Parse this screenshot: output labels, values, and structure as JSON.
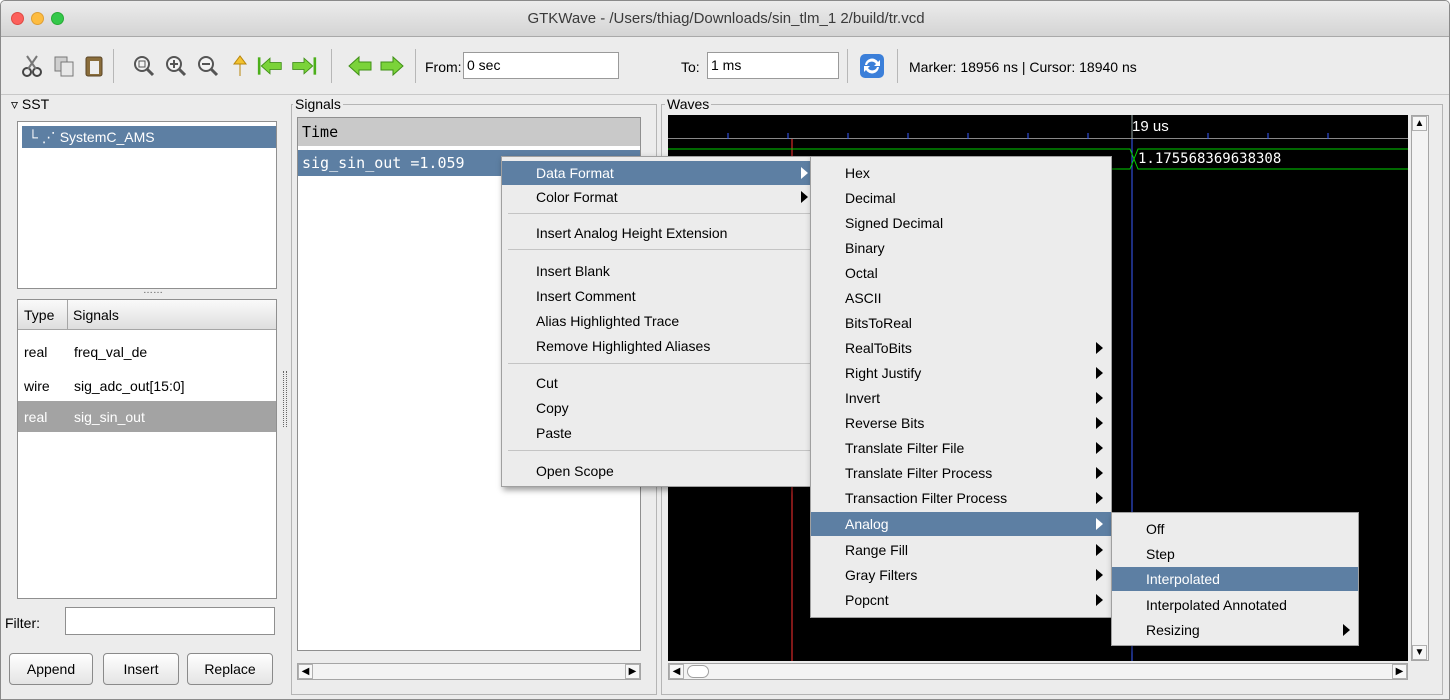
{
  "window": {
    "title": "GTKWave - /Users/thiag/Downloads/sin_tlm_1 2/build/tr.vcd"
  },
  "toolbar": {
    "icons": [
      "cut-icon",
      "copy-icon",
      "paste-icon",
      "zoom-fit-icon",
      "zoom-in-icon",
      "zoom-out-icon",
      "undo-icon",
      "jump-start-icon",
      "jump-end-icon",
      "prev-edge-icon",
      "next-edge-icon",
      "reload-icon"
    ],
    "from_label": "From:",
    "from_value": "0 sec",
    "to_label": "To:",
    "to_value": "1 ms",
    "status": "Marker: 18956 ns  |  Cursor: 18940 ns"
  },
  "sst": {
    "label": "SST",
    "tree_item": "SystemC_AMS",
    "columns": [
      "Type",
      "Signals"
    ],
    "rows": [
      {
        "type": "real",
        "name": "freq_val_de"
      },
      {
        "type": "wire",
        "name": "sig_adc_out[15:0]"
      },
      {
        "type": "real",
        "name": "sig_sin_out"
      }
    ],
    "filter_label": "Filter:",
    "filter_value": "",
    "buttons": {
      "append": "Append",
      "insert": "Insert",
      "replace": "Replace"
    }
  },
  "signals": {
    "label": "Signals",
    "header": "Time",
    "selected": "sig_sin_out =1.059"
  },
  "waves": {
    "label": "Waves",
    "time_label": "19 us",
    "value_label": "1.175568369638308"
  },
  "context_menu": {
    "items": [
      {
        "label": "Data Format",
        "submenu": true
      },
      {
        "label": "Color Format",
        "submenu": true
      },
      {
        "label": "Insert Analog Height Extension",
        "submenu": false
      },
      {
        "label": "Insert Blank",
        "submenu": false
      },
      {
        "label": "Insert Comment",
        "submenu": false
      },
      {
        "label": "Alias Highlighted Trace",
        "submenu": false
      },
      {
        "label": "Remove Highlighted Aliases",
        "submenu": false
      },
      {
        "label": "Cut",
        "submenu": false
      },
      {
        "label": "Copy",
        "submenu": false
      },
      {
        "label": "Paste",
        "submenu": false
      },
      {
        "label": "Open Scope",
        "submenu": false
      }
    ]
  },
  "data_format_menu": {
    "items": [
      {
        "label": "Hex",
        "submenu": false
      },
      {
        "label": "Decimal",
        "submenu": false
      },
      {
        "label": "Signed Decimal",
        "submenu": false
      },
      {
        "label": "Binary",
        "submenu": false
      },
      {
        "label": "Octal",
        "submenu": false
      },
      {
        "label": "ASCII",
        "submenu": false
      },
      {
        "label": "BitsToReal",
        "submenu": false
      },
      {
        "label": "RealToBits",
        "submenu": true
      },
      {
        "label": "Right Justify",
        "submenu": true
      },
      {
        "label": "Invert",
        "submenu": true
      },
      {
        "label": "Reverse Bits",
        "submenu": true
      },
      {
        "label": "Translate Filter File",
        "submenu": true
      },
      {
        "label": "Translate Filter Process",
        "submenu": true
      },
      {
        "label": "Transaction Filter Process",
        "submenu": true
      },
      {
        "label": "Analog",
        "submenu": true
      },
      {
        "label": "Range Fill",
        "submenu": true
      },
      {
        "label": "Gray Filters",
        "submenu": true
      },
      {
        "label": "Popcnt",
        "submenu": true
      }
    ]
  },
  "analog_menu": {
    "items": [
      {
        "label": "Off",
        "submenu": false
      },
      {
        "label": "Step",
        "submenu": false
      },
      {
        "label": "Interpolated",
        "submenu": false
      },
      {
        "label": "Interpolated Annotated",
        "submenu": false
      },
      {
        "label": "Resizing",
        "submenu": true
      }
    ]
  },
  "colors": {
    "highlight": "#5d7fa3",
    "trace": "#00d000",
    "marker": "#ff3030",
    "cursor": "#3a5dff"
  }
}
